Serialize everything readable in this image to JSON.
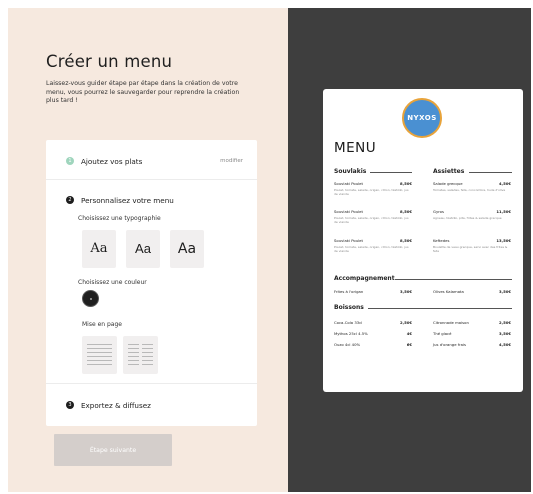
{
  "wizard": {
    "title": "Créer un menu",
    "intro": "Laissez-vous guider étape par étape dans la création de votre menu, vous pourrez le sauvegarder pour reprendre la création plus tard !",
    "step1": {
      "number": "1",
      "title": "Ajoutez vos plats",
      "modify": "modifier"
    },
    "step2": {
      "number": "2",
      "title": "Personnalisez votre menu",
      "typography_label": "Choisissez une typographie",
      "fonts": [
        "Aa",
        "Aa",
        "Aa"
      ],
      "color_label": "Choisissez une couleur",
      "selected_color": "#1f1f1f",
      "layout_label": "Mise en page"
    },
    "step3": {
      "number": "3",
      "title": "Exportez & diffusez"
    },
    "next_button": "Étape suivante"
  },
  "preview": {
    "logo_text": "NYXOS",
    "menu_title": "MENU",
    "sections": {
      "souvlakis": {
        "title": "Souvlakis",
        "items": [
          {
            "name": "Souvlaki Poulet",
            "price": "8,50€",
            "desc": "Poulet, tomate, salade, origan, citron, tzatziki, jus de viande"
          },
          {
            "name": "Souvlaki Poulet",
            "price": "8,50€",
            "desc": "Poulet, tomate, salade, origan, citron, tzatziki, jus de viande"
          },
          {
            "name": "Souvlaki Poulet",
            "price": "8,50€",
            "desc": "Poulet, tomate, salade, origan, citron, tzatziki, jus de viande"
          }
        ]
      },
      "assiettes": {
        "title": "Assiettes",
        "items": [
          {
            "name": "Salade grecque",
            "price": "4,50€",
            "desc": "Tomates, salades, feta, concombre, huile d'olive"
          },
          {
            "name": "Gyros",
            "price": "11,50€",
            "desc": "Agneau, tzatziki, pita, frites & salade grecque"
          },
          {
            "name": "Keftedes",
            "price": "13,50€",
            "desc": "Boulette de veau grecque, servi avec des frites & feta"
          }
        ]
      },
      "accompagnement": {
        "title": "Accompagnement",
        "items": [
          {
            "name": "Frites à l'origan",
            "price": "3,50€"
          },
          {
            "name": "Olives Kalamata",
            "price": "3,50€"
          }
        ]
      },
      "boissons": {
        "title": "Boissons",
        "items": [
          {
            "name": "Coca-Cola 33cl",
            "price": "2,50€"
          },
          {
            "name": "Mythos 25cl 4.5%",
            "price": "4€"
          },
          {
            "name": "Ouzo 4cl 40%",
            "price": "6€"
          },
          {
            "name": "Citronnade maison",
            "price": "2,50€"
          },
          {
            "name": "Thé glacé",
            "price": "3,50€"
          },
          {
            "name": "Jus d'orange frais",
            "price": "4,50€"
          }
        ]
      }
    }
  }
}
